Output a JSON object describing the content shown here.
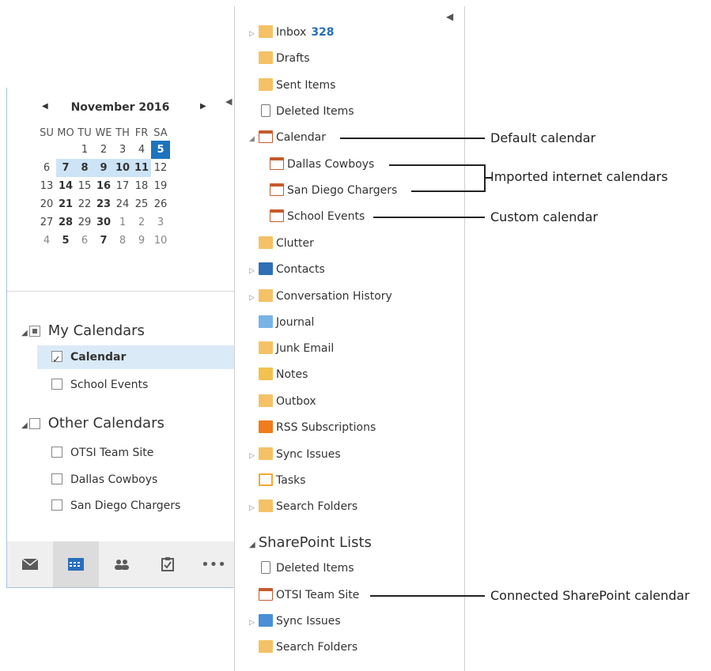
{
  "left": {
    "month_title": "November 2016",
    "weekdays": [
      "SU",
      "MO",
      "TU",
      "WE",
      "TH",
      "FR",
      "SA"
    ],
    "weeks": [
      [
        "",
        "",
        "1",
        "2",
        "3",
        "4",
        "5"
      ],
      [
        "6",
        "7",
        "8",
        "9",
        "10",
        "11",
        "12"
      ],
      [
        "13",
        "14",
        "15",
        "16",
        "17",
        "18",
        "19"
      ],
      [
        "20",
        "21",
        "22",
        "23",
        "24",
        "25",
        "26"
      ],
      [
        "27",
        "28",
        "29",
        "30",
        "1",
        "2",
        "3"
      ],
      [
        "4",
        "5",
        "6",
        "7",
        "8",
        "9",
        "10"
      ]
    ],
    "my_calendars_label": "My Calendars",
    "my_calendars": [
      "Calendar",
      "School Events"
    ],
    "other_calendars_label": "Other Calendars",
    "other_calendars": [
      "OTSI Team Site",
      "Dallas Cowboys",
      "San Diego Chargers"
    ],
    "nav_icons": [
      "mail-icon",
      "calendar-icon",
      "people-icon",
      "tasks-icon",
      "more-icon"
    ],
    "nav_more": "•••"
  },
  "right": {
    "folders": [
      {
        "label": "Inbox",
        "count": "328",
        "icon": "inbox-icon"
      },
      {
        "label": "Drafts",
        "icon": "drafts-icon"
      },
      {
        "label": "Sent Items",
        "icon": "sent-items-icon"
      },
      {
        "label": "Deleted Items",
        "icon": "trash-icon"
      },
      {
        "label": "Calendar",
        "icon": "calendar-icon"
      },
      {
        "label": "Dallas Cowboys",
        "icon": "calendar-icon"
      },
      {
        "label": "San Diego Chargers",
        "icon": "calendar-icon"
      },
      {
        "label": "School Events",
        "icon": "calendar-icon"
      },
      {
        "label": "Clutter",
        "icon": "folder-icon"
      },
      {
        "label": "Contacts",
        "icon": "contacts-icon"
      },
      {
        "label": "Conversation History",
        "icon": "folder-icon"
      },
      {
        "label": "Journal",
        "icon": "journal-icon"
      },
      {
        "label": "Junk Email",
        "icon": "junk-icon"
      },
      {
        "label": "Notes",
        "icon": "notes-icon"
      },
      {
        "label": "Outbox",
        "icon": "outbox-icon"
      },
      {
        "label": "RSS Subscriptions",
        "icon": "rss-icon"
      },
      {
        "label": "Sync Issues",
        "icon": "folder-icon"
      },
      {
        "label": "Tasks",
        "icon": "tasks-icon"
      },
      {
        "label": "Search Folders",
        "icon": "search-folder-icon"
      }
    ],
    "sharepoint_label": "SharePoint Lists",
    "sharepoint_folders": [
      {
        "label": "Deleted Items",
        "icon": "trash-icon"
      },
      {
        "label": "OTSI Team Site",
        "icon": "calendar-icon"
      },
      {
        "label": "Sync Issues",
        "icon": "sync-icon"
      },
      {
        "label": "Search Folders",
        "icon": "search-folder-icon"
      }
    ]
  },
  "callouts": {
    "default_calendar": "Default calendar",
    "imported_calendars": "Imported internet calendars",
    "custom_calendar": "Custom calendar",
    "sharepoint_calendar": "Connected SharePoint calendar"
  },
  "colors": {
    "accent": "#1e73be",
    "selection": "#dbeaf7",
    "count": "#2a6ebb"
  }
}
